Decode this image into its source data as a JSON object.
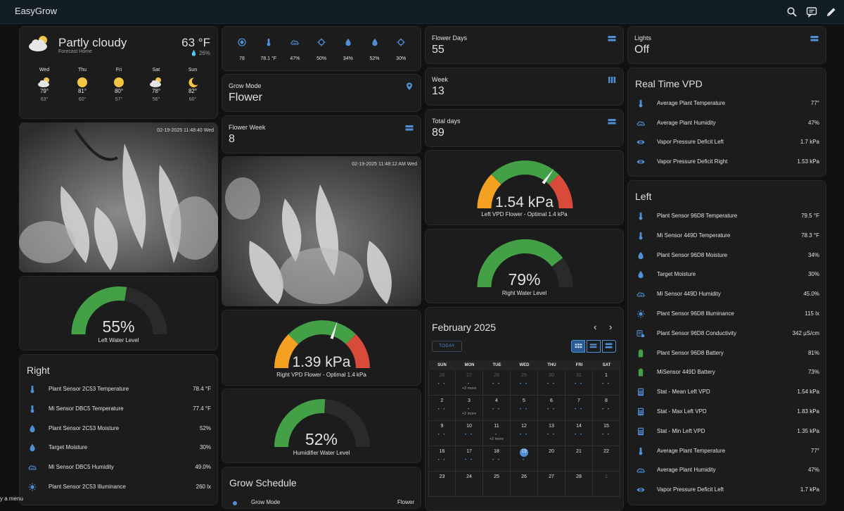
{
  "app": {
    "title": "EasyGrow"
  },
  "weather": {
    "condition": "Partly cloudy",
    "location": "Forecast Home",
    "temp": "63 °F",
    "humidity": "26%",
    "forecast": [
      {
        "day": "Wed",
        "icon": "partly-cloudy-icon",
        "hi": "79°",
        "lo": "63°"
      },
      {
        "day": "Thu",
        "icon": "sunny-icon",
        "hi": "81°",
        "lo": "60°"
      },
      {
        "day": "Fri",
        "icon": "sunny-icon",
        "hi": "80°",
        "lo": "57°"
      },
      {
        "day": "Sat",
        "icon": "partly-cloudy-icon",
        "hi": "78°",
        "lo": "56°"
      },
      {
        "day": "Sun",
        "icon": "clear-night-icon",
        "hi": "82°",
        "lo": "60°"
      }
    ]
  },
  "cameras": {
    "left_timestamp": "02-19-2025 11:48:40 Wed",
    "center_timestamp": "02-19-2025 11:48:12 AM Wed"
  },
  "gauges": {
    "left_water": {
      "value": "55%",
      "label": "Left Water Level",
      "fraction": 0.55
    },
    "right_vpd": {
      "value": "1.39 kPa",
      "label": "Right VPD Flower - Optimal 1.4 kPa",
      "fraction": 0.6
    },
    "humidifier_water": {
      "value": "52%",
      "label": "Humidifier Water Level",
      "fraction": 0.52
    },
    "left_vpd": {
      "value": "1.54 kPa",
      "label": "Left VPD Flower - Optimal 1.4 kPa",
      "fraction": 0.7
    },
    "right_water": {
      "value": "79%",
      "label": "Right Water Level",
      "fraction": 0.79
    },
    "colors": {
      "green": "#43a047",
      "orange": "#f4a020",
      "red": "#d84b3a",
      "track": "#2a2a2a"
    }
  },
  "sensor_strip": [
    {
      "icon": "gauge-icon",
      "value": "78"
    },
    {
      "icon": "thermometer-icon",
      "value": "78.1 °F"
    },
    {
      "icon": "cloud-humidity-icon",
      "value": "47%"
    },
    {
      "icon": "crosshair-icon",
      "value": "50%"
    },
    {
      "icon": "water-drop-icon",
      "value": "34%"
    },
    {
      "icon": "water-drop-icon",
      "value": "52%"
    },
    {
      "icon": "crosshair-icon",
      "value": "30%"
    }
  ],
  "tiles": {
    "grow_mode": {
      "label": "Grow Mode",
      "value": "Flower"
    },
    "flower_week": {
      "label": "Flower Week",
      "value": "8"
    },
    "flower_days": {
      "label": "Flower Days",
      "value": "55"
    },
    "week": {
      "label": "Week",
      "value": "13"
    },
    "total_days": {
      "label": "Total days",
      "value": "89"
    },
    "lights": {
      "label": "Lights",
      "value": "Off"
    }
  },
  "right_list": {
    "title": "Right",
    "rows": [
      {
        "icon": "thermometer-icon",
        "name": "Plant Sensor 2C53 Temperature",
        "value": "78.4 °F"
      },
      {
        "icon": "thermometer-icon",
        "name": "Mi Sensor DBC5 Temperature",
        "value": "77.4 °F"
      },
      {
        "icon": "water-drop-icon",
        "name": "Plant Sensor 2C53 Moisture",
        "value": "52%"
      },
      {
        "icon": "water-drop-icon",
        "name": "Target Moisture",
        "value": "30%"
      },
      {
        "icon": "cloud-humidity-icon",
        "name": "Mi Sensor DBC5 Humidity",
        "value": "49.0%"
      },
      {
        "icon": "illuminance-icon",
        "name": "Plant Sensor 2C53 Illuminance",
        "value": "260 lx"
      }
    ]
  },
  "grow_schedule": {
    "title": "Grow Schedule",
    "row_name": "Grow Mode",
    "row_value": "Flower"
  },
  "calendar": {
    "title": "February 2025",
    "today_label": "TODAY",
    "prev": "‹",
    "next": "›",
    "days_of_week": [
      "SUN",
      "MON",
      "TUE",
      "WED",
      "THU",
      "FRI",
      "SAT"
    ],
    "weeks": [
      [
        {
          "d": "26",
          "o": true,
          "dots": "• •"
        },
        {
          "d": "27",
          "o": true,
          "dots": "•",
          "more": "+2 more"
        },
        {
          "d": "28",
          "o": true,
          "dots": "• •"
        },
        {
          "d": "29",
          "o": true,
          "dots": "• •"
        },
        {
          "d": "30",
          "o": true,
          "dots": "• •"
        },
        {
          "d": "31",
          "o": true,
          "dots": "• •"
        },
        {
          "d": "1",
          "dots": "• •"
        }
      ],
      [
        {
          "d": "2",
          "dots": "• •"
        },
        {
          "d": "3",
          "dots": "•",
          "more": "+2 more"
        },
        {
          "d": "4",
          "dots": "• •"
        },
        {
          "d": "5",
          "dots": "• •"
        },
        {
          "d": "6",
          "dots": "• •"
        },
        {
          "d": "7",
          "dots": "• •"
        },
        {
          "d": "8",
          "dots": "• •"
        }
      ],
      [
        {
          "d": "9",
          "dots": "• •"
        },
        {
          "d": "10",
          "dots": "• •"
        },
        {
          "d": "11",
          "dots": "•",
          "more": "+2 more"
        },
        {
          "d": "12",
          "dots": "• •"
        },
        {
          "d": "13",
          "dots": "• •"
        },
        {
          "d": "14",
          "dots": "• •"
        },
        {
          "d": "15",
          "dots": "• •"
        }
      ],
      [
        {
          "d": "16",
          "dots": "• •"
        },
        {
          "d": "17",
          "dots": "• •"
        },
        {
          "d": "18",
          "dots": "• •"
        },
        {
          "d": "19",
          "today": true,
          "dots": "•"
        },
        {
          "d": "20",
          "dots": ""
        },
        {
          "d": "21",
          "dots": ""
        },
        {
          "d": "22",
          "dots": ""
        }
      ],
      [
        {
          "d": "23",
          "dots": ""
        },
        {
          "d": "24",
          "dots": ""
        },
        {
          "d": "25",
          "dots": ""
        },
        {
          "d": "26",
          "dots": ""
        },
        {
          "d": "27",
          "dots": ""
        },
        {
          "d": "28",
          "dots": ""
        },
        {
          "d": "1",
          "o": true,
          "dots": ""
        }
      ]
    ]
  },
  "realtime_vpd": {
    "title": "Real Time VPD",
    "rows": [
      {
        "icon": "thermometer-icon",
        "name": "Average Plant Temperature",
        "value": "77°"
      },
      {
        "icon": "cloud-humidity-icon",
        "name": "Average Plant Humidity",
        "value": "47%"
      },
      {
        "icon": "eye-icon",
        "name": "Vapor Pressure Deficit Left",
        "value": "1.7 kPa"
      },
      {
        "icon": "eye-icon",
        "name": "Vapor Pressure Deficit Right",
        "value": "1.53 kPa"
      }
    ]
  },
  "left_list": {
    "title": "Left",
    "rows": [
      {
        "icon": "thermometer-icon",
        "name": "Plant Sensor 96D8 Temperature",
        "value": "79.5 °F"
      },
      {
        "icon": "thermometer-icon",
        "name": "Mi Sensor 449D Temperature",
        "value": "78.3 °F"
      },
      {
        "icon": "water-drop-icon",
        "name": "Plant Sensor 96D8 Moisture",
        "value": "34%"
      },
      {
        "icon": "water-drop-icon",
        "name": "Target Moisture",
        "value": "30%"
      },
      {
        "icon": "cloud-humidity-icon",
        "name": "Mi Sensor 449D Humidity",
        "value": "45.0%"
      },
      {
        "icon": "illuminance-icon",
        "name": "Plant Sensor 96D8 Illuminance",
        "value": "115 lx"
      },
      {
        "icon": "conductivity-icon",
        "name": "Plant Sensor 96D8 Conductivity",
        "value": "342 µS/cm"
      },
      {
        "icon": "battery-icon",
        "name": "Plant Sensor 96D8 Battery",
        "value": "81%"
      },
      {
        "icon": "battery-icon",
        "name": "MiSensor 449D Battery",
        "value": "73%"
      },
      {
        "icon": "calculator-icon",
        "name": "Stat - Mean Left VPD",
        "value": "1.54 kPa"
      },
      {
        "icon": "calculator-icon",
        "name": "Stat - Max Left VPD",
        "value": "1.83 kPa"
      },
      {
        "icon": "calculator-icon",
        "name": "Stat - Min Left VPD",
        "value": "1.35 kPa"
      },
      {
        "icon": "thermometer-icon",
        "name": "Average Plant Temperature",
        "value": "77°"
      },
      {
        "icon": "cloud-humidity-icon",
        "name": "Average Plant Humidity",
        "value": "47%"
      },
      {
        "icon": "eye-icon",
        "name": "Vapor Pressure Deficit Left",
        "value": "1.7 kPa"
      }
    ]
  },
  "footer_hint": "y a menu"
}
